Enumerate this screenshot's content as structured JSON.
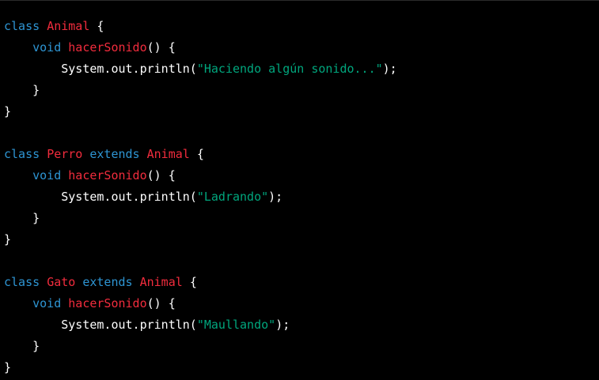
{
  "colors": {
    "background": "#000000",
    "keyword": "#2e95d3",
    "class_name": "#f22c3d",
    "string": "#00a67d",
    "plain": "#ffffff"
  },
  "code": {
    "kw_class": "class",
    "kw_extends": "extends",
    "kw_void": "void",
    "animal": "Animal",
    "perro": "Perro",
    "gato": "Gato",
    "method": "hacerSonido",
    "call": "System.out.println(",
    "str_animal": "\"Haciendo algún sonido...\"",
    "str_perro": "\"Ladrando\"",
    "str_gato": "\"Maullando\"",
    "open_brace": "{",
    "close_brace": "}",
    "parens_brace": "() {",
    "call_end": ");"
  }
}
